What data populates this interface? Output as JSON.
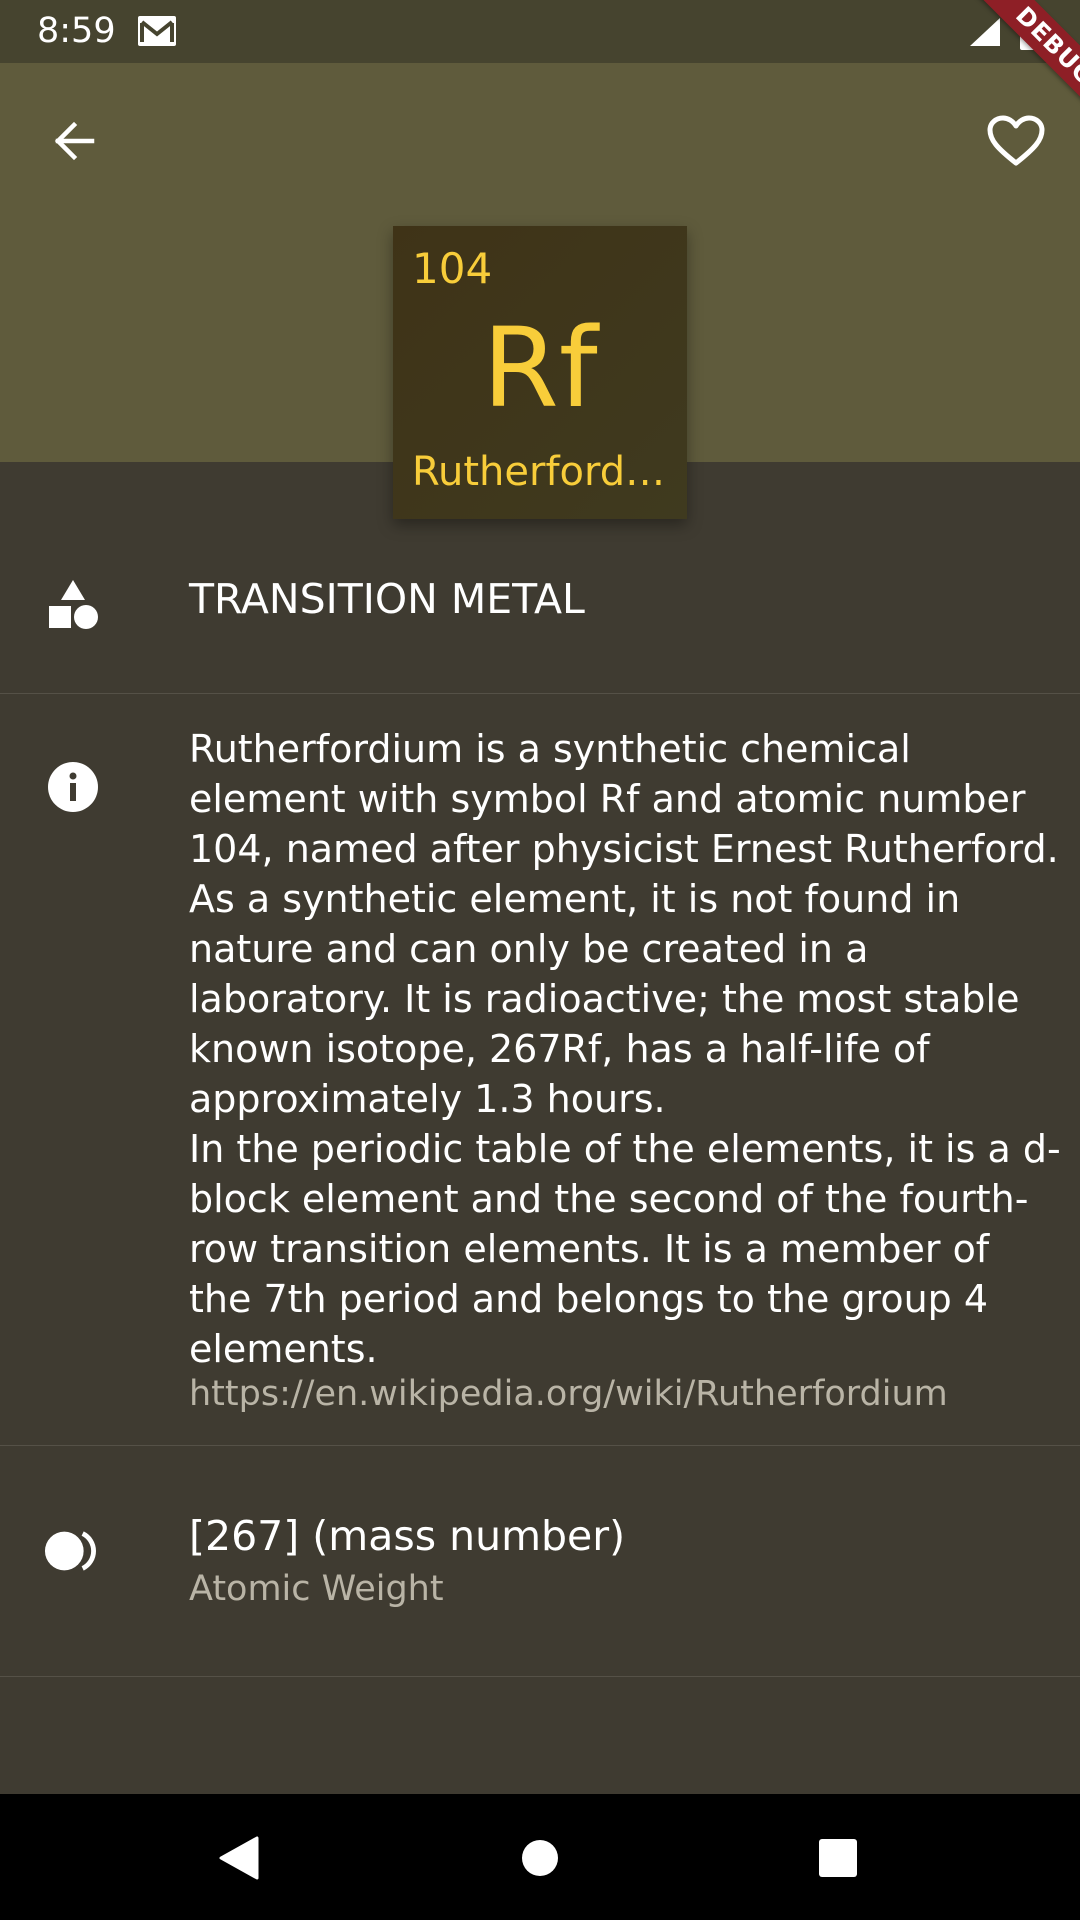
{
  "status_bar": {
    "time": "8:59",
    "icons": [
      "gmail-icon",
      "signal-icon",
      "battery-icon"
    ]
  },
  "debug_banner": "DEBUG",
  "app_bar": {
    "back_icon": "arrow-back-icon",
    "favorite_icon": "heart-outline-icon",
    "background_color": "#5f5b3c"
  },
  "element": {
    "atomic_number": "104",
    "symbol": "Rf",
    "name": "Rutherfordium",
    "tile_text_color": "#f8cd3a"
  },
  "category": {
    "icon": "shapes-icon",
    "label": "TRANSITION METAL"
  },
  "summary": {
    "icon": "info-icon",
    "lines": [
      "Rutherfordium is a synthetic chemical",
      "element with symbol Rf and atomic number",
      "104, named after physicist Ernest Rutherford.",
      "As a synthetic element, it is not found in",
      "nature and can only be created in a",
      "laboratory. It is radioactive; the most stable",
      "known isotope, 267Rf, has a half-life of",
      "approximately 1.3 hours.",
      "In the periodic table of the elements, it is a d-",
      "block element and the second of the fourth-",
      "row transition elements. It is a member of",
      "the 7th period and belongs to the group 4",
      "elements."
    ],
    "source_url": "https://en.wikipedia.org/wiki/Rutherfordium"
  },
  "atomic_weight": {
    "icon": "atom-weight-icon",
    "value": "[267] (mass number)",
    "label": "Atomic Weight"
  },
  "nav_bar": {
    "icons": [
      "nav-back-icon",
      "nav-home-icon",
      "nav-recents-icon"
    ]
  }
}
